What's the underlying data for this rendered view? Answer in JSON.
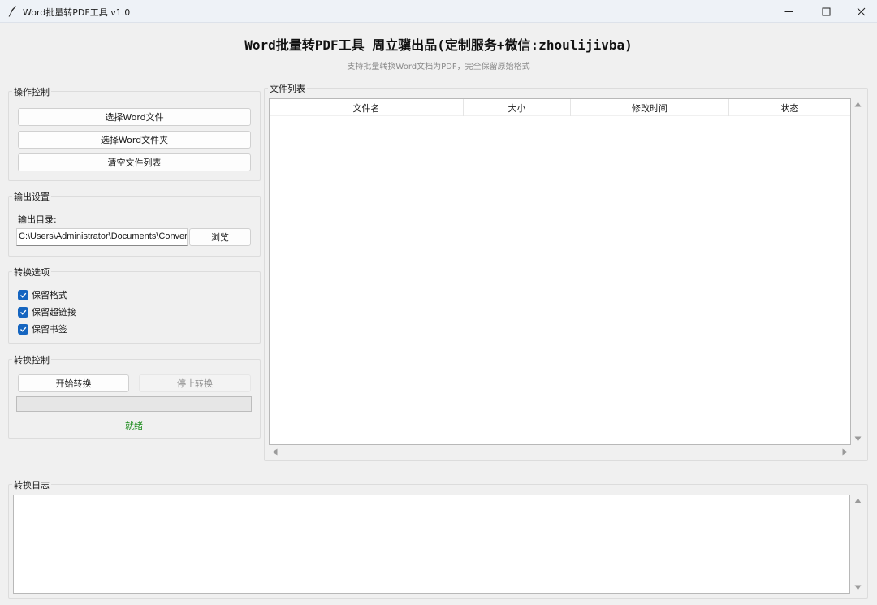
{
  "window": {
    "title": "Word批量转PDF工具 v1.0",
    "controls": [
      "minimize",
      "maximize",
      "close"
    ]
  },
  "header": {
    "title": "Word批量转PDF工具 周立骥出品(定制服务+微信:zhoulijivba)",
    "subtitle": "支持批量转换Word文档为PDF，完全保留原始格式"
  },
  "operation": {
    "group_label": "操作控制",
    "select_files": "选择Word文件",
    "select_folder": "选择Word文件夹",
    "clear_list": "清空文件列表"
  },
  "output": {
    "group_label": "输出设置",
    "dir_label": "输出目录:",
    "dir_value": "C:\\Users\\Administrator\\Documents\\Converted",
    "browse": "浏览"
  },
  "options": {
    "group_label": "转换选项",
    "items": [
      {
        "label": "保留格式",
        "checked": true
      },
      {
        "label": "保留超链接",
        "checked": true
      },
      {
        "label": "保留书签",
        "checked": true
      }
    ]
  },
  "control": {
    "group_label": "转换控制",
    "start": "开始转换",
    "stop": "停止转换",
    "progress": 0,
    "status": "就绪",
    "status_color": "#1c8c1c"
  },
  "file_list": {
    "group_label": "文件列表",
    "columns": [
      "文件名",
      "大小",
      "修改时间",
      "状态"
    ],
    "rows": []
  },
  "log": {
    "group_label": "转换日志",
    "content": ""
  },
  "colors": {
    "checkbox": "#1565c0",
    "background": "#f0f0f0"
  }
}
